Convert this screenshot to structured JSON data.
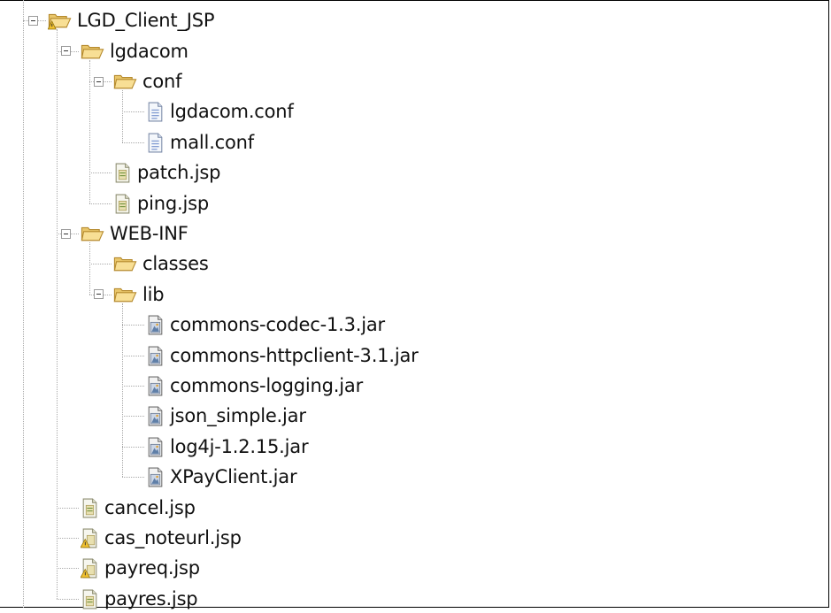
{
  "tree": {
    "items": [
      {
        "label": "LGD_Client_JSP",
        "type": "project-folder",
        "level": 0,
        "expanded": true
      },
      {
        "label": "lgdacom",
        "type": "folder",
        "level": 1,
        "expanded": true
      },
      {
        "label": "conf",
        "type": "folder",
        "level": 2,
        "expanded": true
      },
      {
        "label": "lgdacom.conf",
        "type": "text-file",
        "level": 3
      },
      {
        "label": "mall.conf",
        "type": "text-file",
        "level": 3
      },
      {
        "label": "patch.jsp",
        "type": "jsp-file",
        "level": 2
      },
      {
        "label": "ping.jsp",
        "type": "jsp-file",
        "level": 2
      },
      {
        "label": "WEB-INF",
        "type": "folder",
        "level": 1,
        "expanded": true
      },
      {
        "label": "classes",
        "type": "folder",
        "level": 2
      },
      {
        "label": "lib",
        "type": "folder",
        "level": 2,
        "expanded": true
      },
      {
        "label": "commons-codec-1.3.jar",
        "type": "jar-file",
        "level": 3
      },
      {
        "label": "commons-httpclient-3.1.jar",
        "type": "jar-file",
        "level": 3
      },
      {
        "label": "commons-logging.jar",
        "type": "jar-file",
        "level": 3
      },
      {
        "label": "json_simple.jar",
        "type": "jar-file",
        "level": 3
      },
      {
        "label": "log4j-1.2.15.jar",
        "type": "jar-file",
        "level": 3
      },
      {
        "label": "XPayClient.jar",
        "type": "jar-file",
        "level": 3
      },
      {
        "label": "cancel.jsp",
        "type": "jsp-file",
        "level": 1
      },
      {
        "label": "cas_noteurl.jsp",
        "type": "jsp-file-warning",
        "level": 1
      },
      {
        "label": "payreq.jsp",
        "type": "jsp-file-warning",
        "level": 1
      },
      {
        "label": "payres.jsp",
        "type": "jsp-file",
        "level": 1
      }
    ]
  },
  "icons": {
    "project-folder": "open-folder-warning-icon",
    "folder": "open-folder-icon",
    "text-file": "text-file-icon",
    "jsp-file": "jsp-file-icon",
    "jsp-file-warning": "jsp-file-warning-icon",
    "jar-file": "jar-file-icon"
  },
  "colors": {
    "folder_fill": "#f5d98b",
    "folder_stroke": "#b58a2e",
    "warning": "#f2c230",
    "tree_line": "#a9a9a9",
    "text": "#111111"
  }
}
